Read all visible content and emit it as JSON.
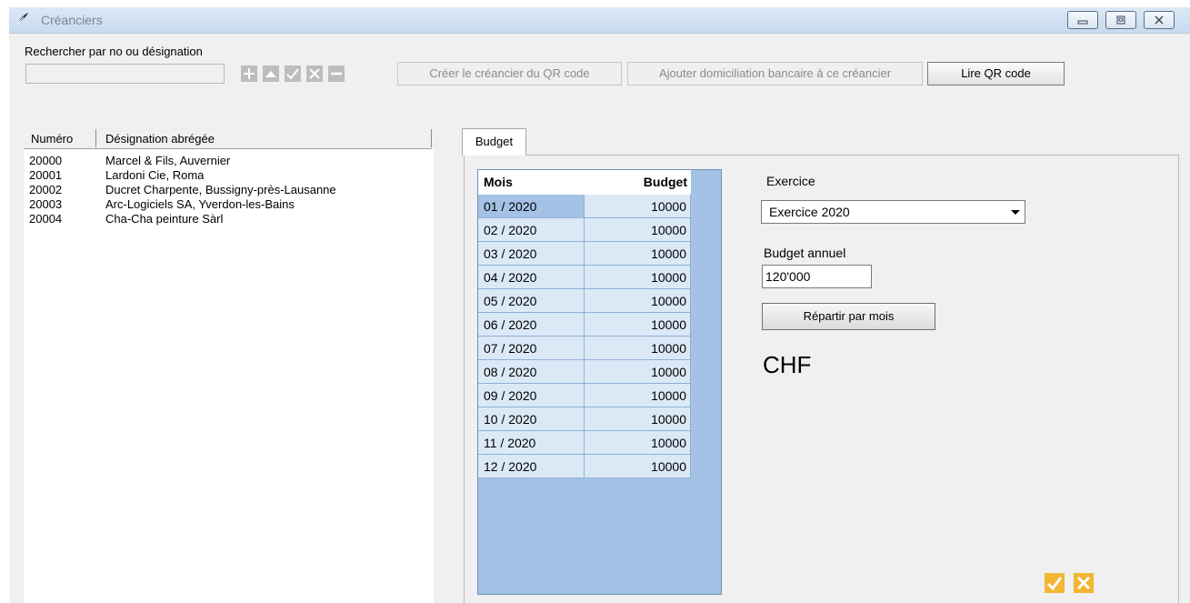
{
  "window": {
    "title": "Créanciers",
    "controls": [
      "minimize",
      "restore",
      "close"
    ]
  },
  "search": {
    "label": "Rechercher par no ou désignation",
    "value": "",
    "tools": [
      "plus-icon",
      "up-arrow-icon",
      "check-icon",
      "close-x-icon",
      "minus-icon"
    ]
  },
  "toolbar": {
    "create_qr_label": "Créer le créancier du QR code",
    "add_domiciliation_label": "Ajouter domiciliation bancaire à ce créancier",
    "read_qr_label": "Lire QR code"
  },
  "list": {
    "columns": [
      "Numéro",
      "Désignation abrégée"
    ],
    "rows": [
      {
        "num": "20000",
        "des": "Marcel & Fils, Auvernier"
      },
      {
        "num": "20001",
        "des": "Lardoni Cie, Roma"
      },
      {
        "num": "20002",
        "des": "Ducret Charpente, Bussigny-près-Lausanne"
      },
      {
        "num": "20003",
        "des": "Arc-Logiciels SA, Yverdon-les-Bains"
      },
      {
        "num": "20004",
        "des": "Cha-Cha peinture Sàrl"
      }
    ]
  },
  "tabs": [
    {
      "label": "Budget",
      "active": true
    }
  ],
  "budget_grid": {
    "headers": [
      "Mois",
      "Budget"
    ],
    "rows": [
      {
        "mois": "01 / 2020",
        "budget": "10000"
      },
      {
        "mois": "02 / 2020",
        "budget": "10000"
      },
      {
        "mois": "03 / 2020",
        "budget": "10000"
      },
      {
        "mois": "04 / 2020",
        "budget": "10000"
      },
      {
        "mois": "05 / 2020",
        "budget": "10000"
      },
      {
        "mois": "06 / 2020",
        "budget": "10000"
      },
      {
        "mois": "07 / 2020",
        "budget": "10000"
      },
      {
        "mois": "08 / 2020",
        "budget": "10000"
      },
      {
        "mois": "09 / 2020",
        "budget": "10000"
      },
      {
        "mois": "10 / 2020",
        "budget": "10000"
      },
      {
        "mois": "11 / 2020",
        "budget": "10000"
      },
      {
        "mois": "12 / 2020",
        "budget": "10000"
      }
    ],
    "selected_row": 0
  },
  "form": {
    "exercice_label": "Exercice",
    "exercice_value": "Exercice 2020",
    "budget_annuel_label": "Budget annuel",
    "budget_annuel_value": "120'000",
    "repartir_label": "Répartir par mois",
    "currency": "CHF"
  },
  "colors": {
    "grid_background": "#a4c2e6",
    "grid_cell": "#dbe9f7",
    "title_bar": "#dbe8f6",
    "confirm_icon": "#f2b632"
  }
}
